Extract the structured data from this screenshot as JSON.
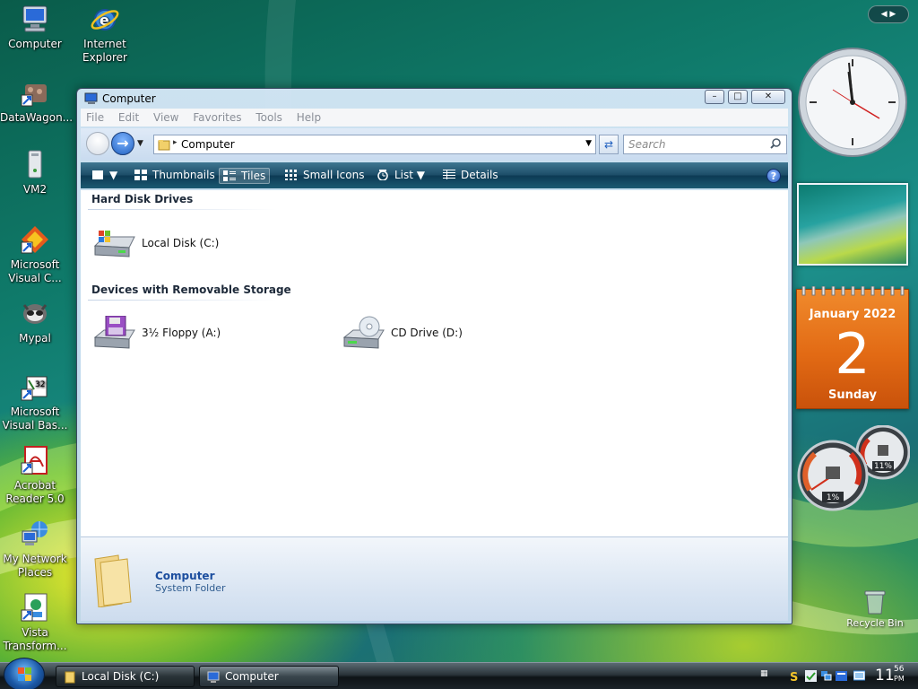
{
  "desktop": {
    "icons": [
      {
        "label": "Computer",
        "icon": "computer-icon"
      },
      {
        "label": "Internet Explorer",
        "icon": "internet-explorer-icon"
      },
      {
        "label": "DataWagon...",
        "icon": "datawagon-icon"
      },
      {
        "label": "VM2",
        "icon": "vm2-icon"
      },
      {
        "label": "Microsoft Visual C...",
        "icon": "visual-c-icon"
      },
      {
        "label": "Mypal",
        "icon": "mypal-icon"
      },
      {
        "label": "Microsoft Visual Bas...",
        "icon": "visual-basic-icon"
      },
      {
        "label": "Acrobat Reader 5.0",
        "icon": "acrobat-icon"
      },
      {
        "label": "My Network Places",
        "icon": "network-places-icon"
      },
      {
        "label": "Vista Transform...",
        "icon": "vista-transform-icon"
      },
      {
        "label": "Recycle Bin",
        "icon": "recycle-bin-icon"
      }
    ]
  },
  "window": {
    "title": "Computer",
    "controls": {
      "minimize": "–",
      "maximize": "□",
      "close": "✕"
    },
    "menu": [
      "File",
      "Edit",
      "View",
      "Favorites",
      "Tools",
      "Help"
    ],
    "address": {
      "path": "Computer"
    },
    "search": {
      "placeholder": "Search"
    },
    "toolbar": {
      "views": [
        {
          "label": "Thumbnails",
          "icon": "thumbnails-icon"
        },
        {
          "label": "Tiles",
          "icon": "tiles-icon",
          "selected": true
        },
        {
          "label": "Small Icons",
          "icon": "small-icons-icon"
        },
        {
          "label": "List",
          "icon": "list-icon"
        },
        {
          "label": "Details",
          "icon": "details-icon"
        }
      ],
      "help": "?"
    },
    "groups": [
      {
        "heading": "Hard Disk Drives",
        "items": [
          {
            "label": "Local Disk (C:)",
            "icon": "hard-disk-icon"
          }
        ]
      },
      {
        "heading": "Devices with Removable Storage",
        "items": [
          {
            "label": "3½ Floppy (A:)",
            "icon": "floppy-drive-icon"
          },
          {
            "label": "CD Drive (D:)",
            "icon": "cd-drive-icon"
          }
        ]
      }
    ],
    "details_pane": {
      "name": "Computer",
      "type": "System Folder"
    }
  },
  "sidebar": {
    "calendar": {
      "month": "January 2022",
      "day": "2",
      "weekday": "Sunday"
    },
    "meters": {
      "cpu": "1%",
      "memory": "11%"
    }
  },
  "taskbar": {
    "tasks": [
      {
        "label": "Local Disk (C:)",
        "icon": "folder-icon",
        "active": false
      },
      {
        "label": "Computer",
        "icon": "computer-icon",
        "active": true
      }
    ],
    "clock": {
      "hour": "11",
      "minute": "56",
      "ampm": "PM"
    }
  },
  "colors": {
    "toolbar": "#1d4e69",
    "calendar": "#e26a14",
    "link": "#1b4d9e"
  }
}
